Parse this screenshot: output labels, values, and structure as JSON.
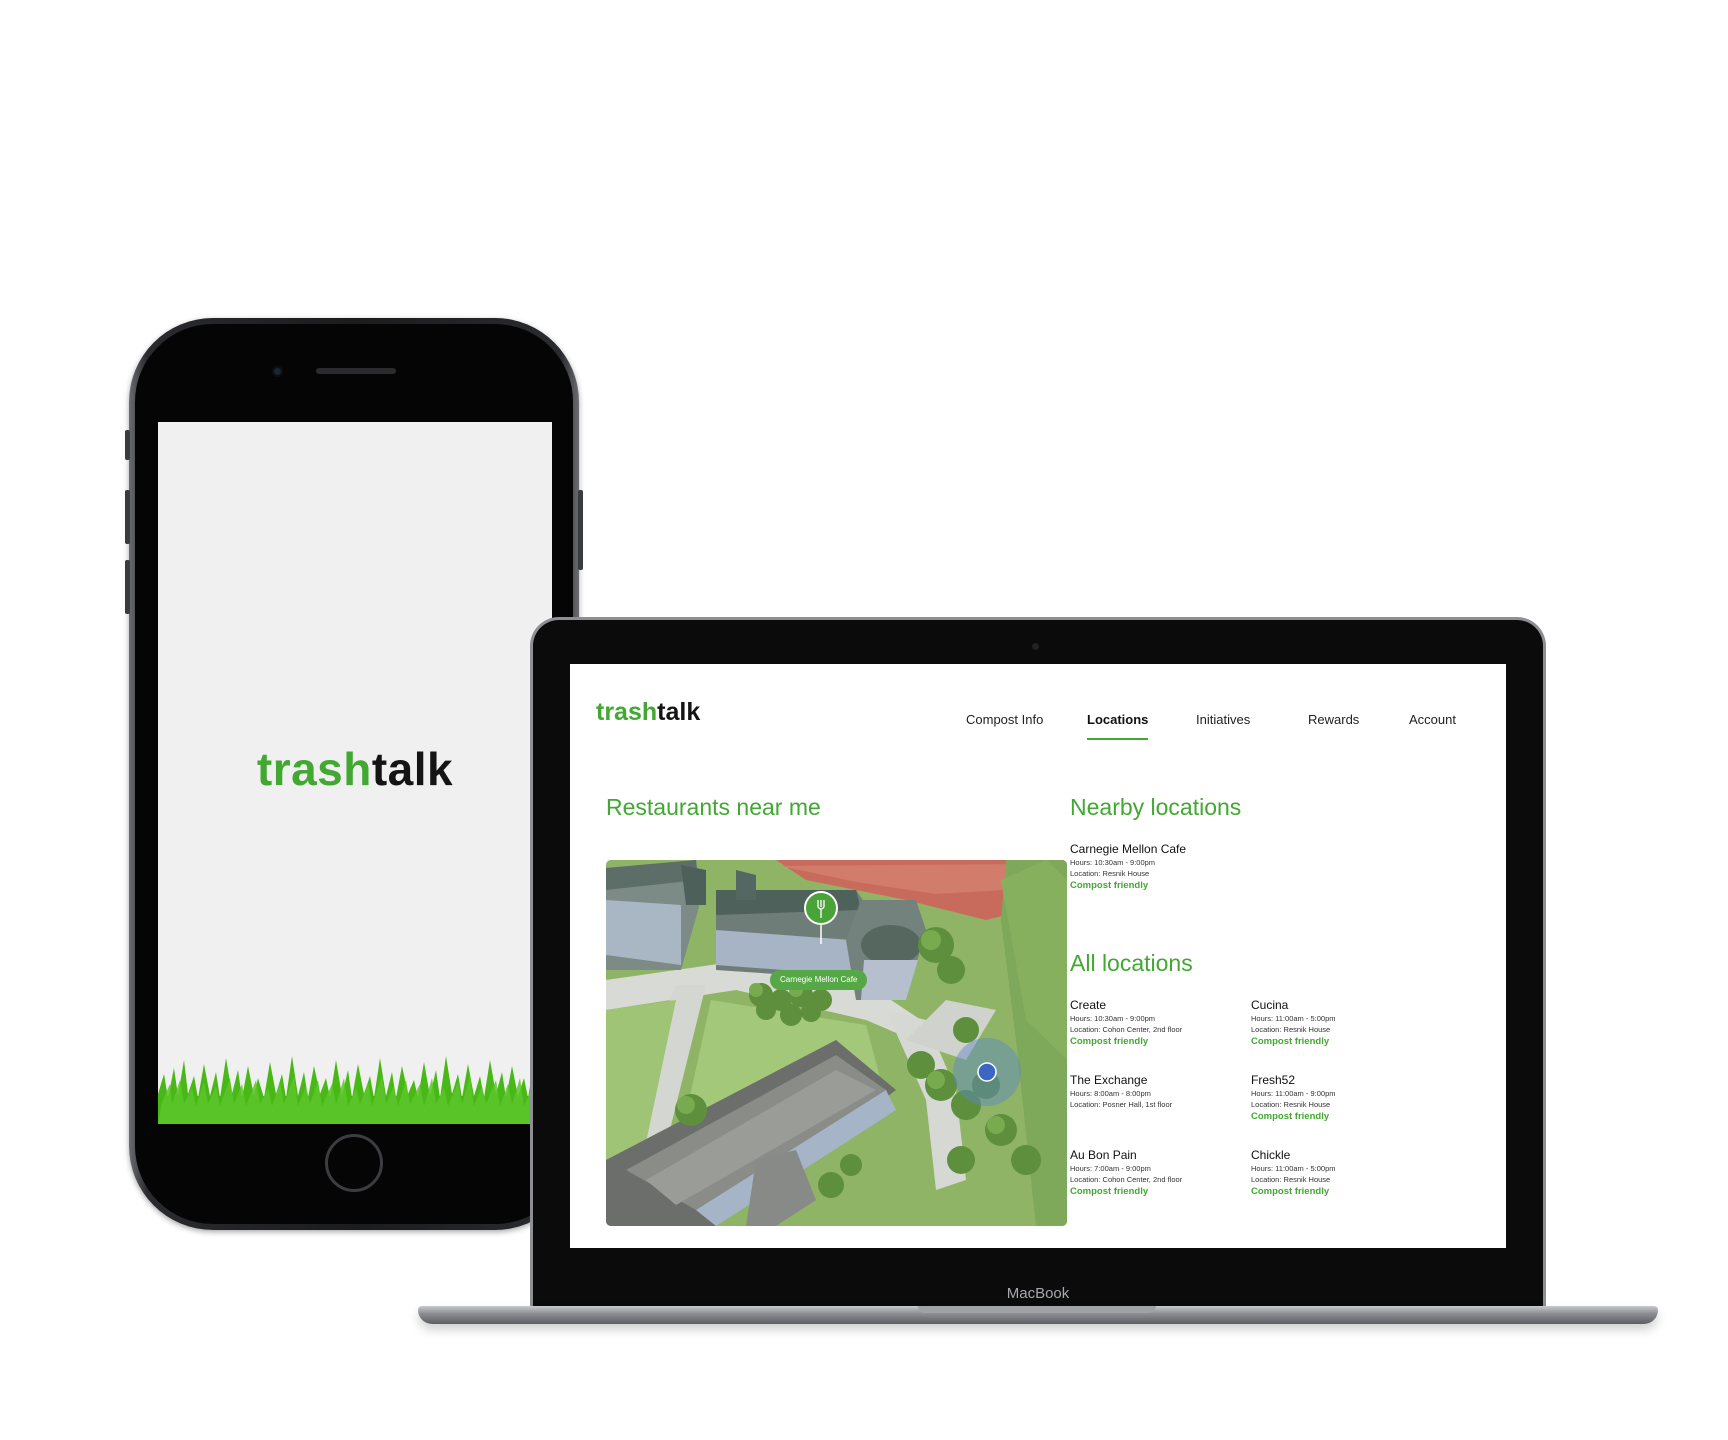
{
  "phone": {
    "logo": {
      "part1": "trash",
      "part2": "talk"
    }
  },
  "laptop": {
    "brand_label": "MacBook",
    "site": {
      "logo": {
        "part1": "trash",
        "part2": "talk"
      },
      "nav": [
        {
          "label": "Compost Info",
          "active": false
        },
        {
          "label": "Locations",
          "active": true
        },
        {
          "label": "Initiatives",
          "active": false
        },
        {
          "label": "Rewards",
          "active": false
        },
        {
          "label": "Account",
          "active": false
        }
      ],
      "map_section": {
        "title": "Restaurants near me",
        "pin_label": "Carnegie Mellon Cafe"
      },
      "nearby": {
        "title": "Nearby locations",
        "items": [
          {
            "name": "Carnegie Mellon Cafe",
            "hours": "Hours: 10:30am - 9:00pm",
            "location": "Location: Resnik House",
            "tag": "Compost friendly"
          }
        ]
      },
      "all": {
        "title": "All locations",
        "items": [
          {
            "name": "Create",
            "hours": "Hours: 10:30am - 9:00pm",
            "location": "Location: Cohon Center, 2nd floor",
            "tag": "Compost friendly"
          },
          {
            "name": "Cucina",
            "hours": "Hours: 11:00am - 5:00pm",
            "location": "Location: Resnik House",
            "tag": "Compost friendly"
          },
          {
            "name": "The Exchange",
            "hours": "Hours: 8:00am - 8:00pm",
            "location": "Location: Posner Hall, 1st floor",
            "tag": ""
          },
          {
            "name": "Fresh52",
            "hours": "Hours: 11:00am - 9:00pm",
            "location": "Location: Resnik House",
            "tag": "Compost friendly"
          },
          {
            "name": "Au Bon Pain",
            "hours": "Hours: 7:00am - 9:00pm",
            "location": "Location: Cohon Center, 2nd floor",
            "tag": "Compost friendly"
          },
          {
            "name": "Chickle",
            "hours": "Hours: 11:00am - 5:00pm",
            "location": "Location: Resnik House",
            "tag": "Compost friendly"
          }
        ]
      }
    }
  },
  "colors": {
    "accent": "#42a832",
    "text": "#141414",
    "splash_bg": "#f0f0f0"
  }
}
